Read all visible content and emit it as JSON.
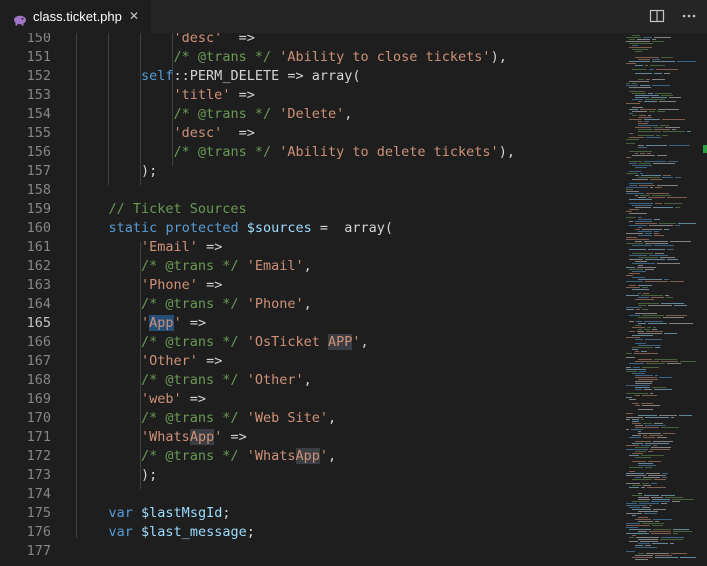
{
  "tab": {
    "filename": "class.ticket.php",
    "close_glyph": "✕",
    "icon": "php-elephant-icon"
  },
  "toolbar": {
    "split_icon": "split-editor-icon",
    "more_icon": "more-actions-icon"
  },
  "colors": {
    "string": "#ce9178",
    "comment": "#6a9955",
    "keyword": "#569cd6",
    "variable": "#9cdcfe",
    "default": "#d4d4d4"
  },
  "current_line": 165,
  "lines": [
    {
      "num": "150",
      "tokens": [
        {
          "t": "            "
        },
        {
          "t": "'desc'",
          "c": "str"
        },
        {
          "t": "  =>"
        }
      ]
    },
    {
      "num": "151",
      "tokens": [
        {
          "t": "            "
        },
        {
          "t": "/* @trans */",
          "c": "cmt"
        },
        {
          "t": " "
        },
        {
          "t": "'Ability to close tickets'",
          "c": "str"
        },
        {
          "t": "),"
        }
      ]
    },
    {
      "num": "152",
      "tokens": [
        {
          "t": "        "
        },
        {
          "t": "self",
          "c": "kw"
        },
        {
          "t": "::PERM_DELETE => array("
        }
      ]
    },
    {
      "num": "153",
      "tokens": [
        {
          "t": "            "
        },
        {
          "t": "'title'",
          "c": "str"
        },
        {
          "t": " =>"
        }
      ]
    },
    {
      "num": "154",
      "tokens": [
        {
          "t": "            "
        },
        {
          "t": "/* @trans */",
          "c": "cmt"
        },
        {
          "t": " "
        },
        {
          "t": "'Delete'",
          "c": "str"
        },
        {
          "t": ","
        }
      ]
    },
    {
      "num": "155",
      "tokens": [
        {
          "t": "            "
        },
        {
          "t": "'desc'",
          "c": "str"
        },
        {
          "t": "  =>"
        }
      ]
    },
    {
      "num": "156",
      "tokens": [
        {
          "t": "            "
        },
        {
          "t": "/* @trans */",
          "c": "cmt"
        },
        {
          "t": " "
        },
        {
          "t": "'Ability to delete tickets'",
          "c": "str"
        },
        {
          "t": "),"
        }
      ]
    },
    {
      "num": "157",
      "tokens": [
        {
          "t": "        );"
        }
      ]
    },
    {
      "num": "158",
      "tokens": []
    },
    {
      "num": "159",
      "tokens": [
        {
          "t": "    "
        },
        {
          "t": "// Ticket Sources",
          "c": "cmt"
        }
      ]
    },
    {
      "num": "160",
      "tokens": [
        {
          "t": "    "
        },
        {
          "t": "static",
          "c": "kw"
        },
        {
          "t": " "
        },
        {
          "t": "protected",
          "c": "kw"
        },
        {
          "t": " "
        },
        {
          "t": "$sources",
          "c": "var"
        },
        {
          "t": " =  array("
        }
      ]
    },
    {
      "num": "161",
      "tokens": [
        {
          "t": "        "
        },
        {
          "t": "'Email'",
          "c": "str"
        },
        {
          "t": " =>"
        }
      ]
    },
    {
      "num": "162",
      "tokens": [
        {
          "t": "        "
        },
        {
          "t": "/* @trans */",
          "c": "cmt"
        },
        {
          "t": " "
        },
        {
          "t": "'Email'",
          "c": "str"
        },
        {
          "t": ","
        }
      ]
    },
    {
      "num": "163",
      "tokens": [
        {
          "t": "        "
        },
        {
          "t": "'Phone'",
          "c": "str"
        },
        {
          "t": " =>"
        }
      ]
    },
    {
      "num": "164",
      "tokens": [
        {
          "t": "        "
        },
        {
          "t": "/* @trans */",
          "c": "cmt"
        },
        {
          "t": " "
        },
        {
          "t": "'Phone'",
          "c": "str"
        },
        {
          "t": ","
        }
      ]
    },
    {
      "num": "165",
      "tokens": [
        {
          "t": "        "
        },
        {
          "t": "'",
          "c": "str"
        },
        {
          "t": "App",
          "c": "sel"
        },
        {
          "t": "'",
          "c": "str"
        },
        {
          "t": " =>"
        }
      ]
    },
    {
      "num": "166",
      "tokens": [
        {
          "t": "        "
        },
        {
          "t": "/* @trans */",
          "c": "cmt"
        },
        {
          "t": " "
        },
        {
          "t": "'OsTicket ",
          "c": "str"
        },
        {
          "t": "APP",
          "c": "strhl"
        },
        {
          "t": "'",
          "c": "str"
        },
        {
          "t": ","
        }
      ]
    },
    {
      "num": "167",
      "tokens": [
        {
          "t": "        "
        },
        {
          "t": "'Other'",
          "c": "str"
        },
        {
          "t": " =>"
        }
      ]
    },
    {
      "num": "168",
      "tokens": [
        {
          "t": "        "
        },
        {
          "t": "/* @trans */",
          "c": "cmt"
        },
        {
          "t": " "
        },
        {
          "t": "'Other'",
          "c": "str"
        },
        {
          "t": ","
        }
      ]
    },
    {
      "num": "169",
      "tokens": [
        {
          "t": "        "
        },
        {
          "t": "'web'",
          "c": "str"
        },
        {
          "t": " =>"
        }
      ]
    },
    {
      "num": "170",
      "tokens": [
        {
          "t": "        "
        },
        {
          "t": "/* @trans */",
          "c": "cmt"
        },
        {
          "t": " "
        },
        {
          "t": "'Web Site'",
          "c": "str"
        },
        {
          "t": ","
        }
      ]
    },
    {
      "num": "171",
      "tokens": [
        {
          "t": "        "
        },
        {
          "t": "'Whats",
          "c": "str"
        },
        {
          "t": "App",
          "c": "strhl"
        },
        {
          "t": "'",
          "c": "str"
        },
        {
          "t": " =>"
        }
      ]
    },
    {
      "num": "172",
      "tokens": [
        {
          "t": "        "
        },
        {
          "t": "/* @trans */",
          "c": "cmt"
        },
        {
          "t": " "
        },
        {
          "t": "'Whats",
          "c": "str"
        },
        {
          "t": "App",
          "c": "strhl"
        },
        {
          "t": "'",
          "c": "str"
        },
        {
          "t": ","
        }
      ]
    },
    {
      "num": "173",
      "tokens": [
        {
          "t": "        );"
        }
      ]
    },
    {
      "num": "174",
      "tokens": []
    },
    {
      "num": "175",
      "tokens": [
        {
          "t": "    "
        },
        {
          "t": "var",
          "c": "kw"
        },
        {
          "t": " "
        },
        {
          "t": "$lastMsgId",
          "c": "var"
        },
        {
          "t": ";"
        }
      ]
    },
    {
      "num": "176",
      "tokens": [
        {
          "t": "    "
        },
        {
          "t": "var",
          "c": "kw"
        },
        {
          "t": " "
        },
        {
          "t": "$last_message",
          "c": "var"
        },
        {
          "t": ";"
        }
      ]
    },
    {
      "num": "177",
      "tokens": []
    }
  ]
}
